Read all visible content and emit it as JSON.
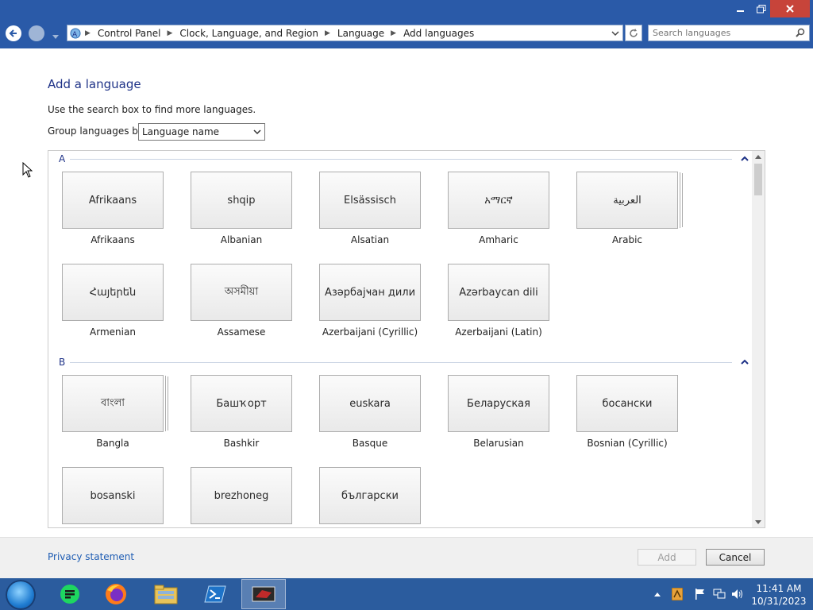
{
  "window": {
    "controls": [
      "minimize",
      "maximize",
      "close"
    ]
  },
  "nav": {
    "breadcrumbs": [
      "Control Panel",
      "Clock, Language, and Region",
      "Language",
      "Add languages"
    ],
    "search_placeholder": "Search languages"
  },
  "page": {
    "title": "Add a language",
    "hint": "Use the search box to find more languages.",
    "group_label": "Group languages by:",
    "group_value": "Language name"
  },
  "groups": [
    {
      "letter": "A",
      "languages": [
        {
          "native": "Afrikaans",
          "name": "Afrikaans"
        },
        {
          "native": "shqip",
          "name": "Albanian"
        },
        {
          "native": "Elsässisch",
          "name": "Alsatian"
        },
        {
          "native": "አማርኛ",
          "name": "Amharic"
        },
        {
          "native": "العربية",
          "name": "Arabic"
        },
        {
          "native": "Հայերեն",
          "name": "Armenian"
        },
        {
          "native": "অসমীয়া",
          "name": "Assamese"
        },
        {
          "native": "Азәрбајҹан дили",
          "name": "Azerbaijani (Cyrillic)"
        },
        {
          "native": "Azərbaycan dili",
          "name": "Azerbaijani (Latin)"
        }
      ]
    },
    {
      "letter": "B",
      "languages": [
        {
          "native": "বাংলা",
          "name": "Bangla"
        },
        {
          "native": "Башҡорт",
          "name": "Bashkir"
        },
        {
          "native": "euskara",
          "name": "Basque"
        },
        {
          "native": "Беларуская",
          "name": "Belarusian"
        },
        {
          "native": "босански",
          "name": "Bosnian (Cyrillic)"
        },
        {
          "native": "bosanski",
          "name": ""
        },
        {
          "native": "brezhoneg",
          "name": ""
        },
        {
          "native": "български",
          "name": ""
        }
      ]
    }
  ],
  "footer": {
    "privacy": "Privacy statement",
    "add": "Add",
    "cancel": "Cancel"
  },
  "taskbar": {
    "time": "11:41 AM",
    "date": "10/31/2023"
  }
}
